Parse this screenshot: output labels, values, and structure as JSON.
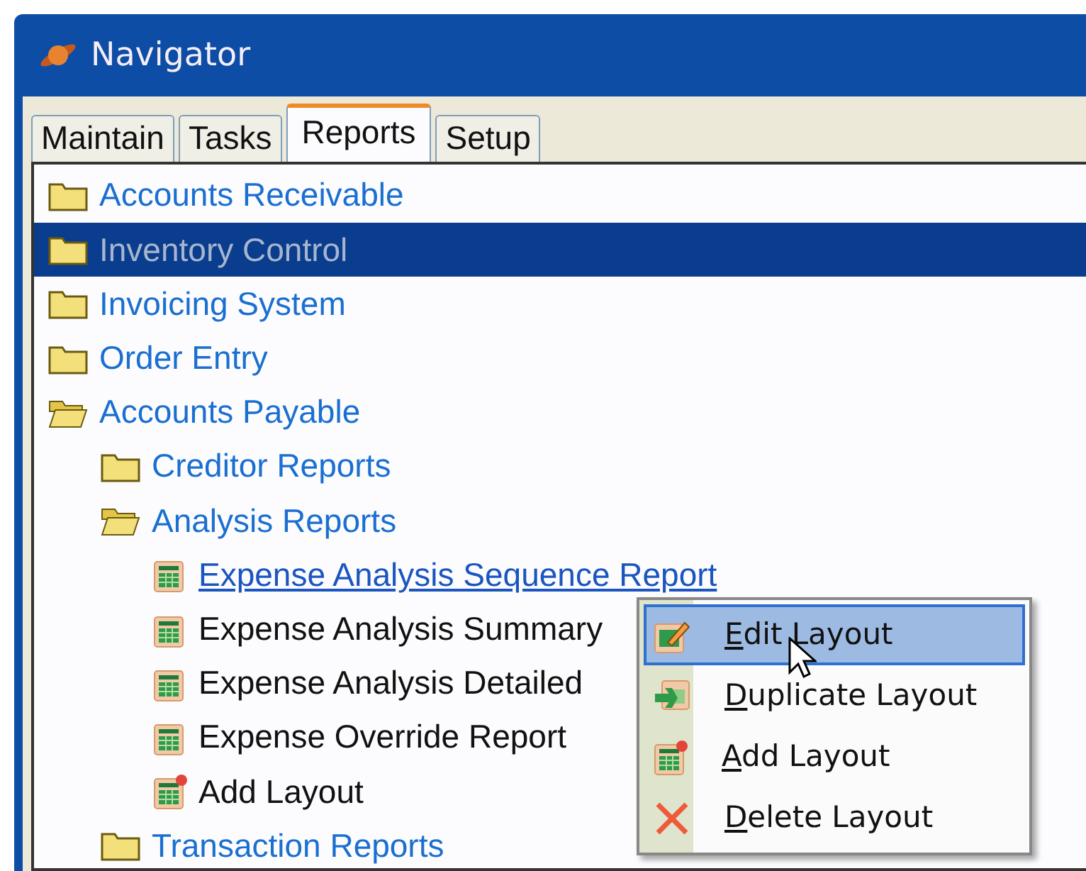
{
  "window": {
    "title": "Navigator"
  },
  "tabs": [
    {
      "label": "Maintain",
      "selected": false
    },
    {
      "label": "Tasks",
      "selected": false
    },
    {
      "label": "Reports",
      "selected": true
    },
    {
      "label": "Setup",
      "selected": false
    }
  ],
  "tree": [
    {
      "label": "Accounts Receivable",
      "kind": "folder",
      "expanded": false,
      "selected": false
    },
    {
      "label": "Inventory Control",
      "kind": "folder",
      "expanded": false,
      "selected": true
    },
    {
      "label": "Invoicing System",
      "kind": "folder",
      "expanded": false,
      "selected": false
    },
    {
      "label": "Order Entry",
      "kind": "folder",
      "expanded": false,
      "selected": false
    },
    {
      "label": "Accounts Payable",
      "kind": "folder",
      "expanded": true,
      "selected": false,
      "children": [
        {
          "label": "Creditor Reports",
          "kind": "folder",
          "expanded": false,
          "selected": false
        },
        {
          "label": "Analysis Reports",
          "kind": "folder",
          "expanded": true,
          "selected": false,
          "children": [
            {
              "label": "Expense Analysis Sequence Report",
              "kind": "report",
              "hovered": true,
              "selected": false
            },
            {
              "label": "Expense Analysis Summary",
              "kind": "report",
              "hovered": false,
              "selected": false
            },
            {
              "label": "Expense Analysis Detailed",
              "kind": "report",
              "hovered": false,
              "selected": false
            },
            {
              "label": "Expense Override Report",
              "kind": "report",
              "hovered": false,
              "selected": false
            },
            {
              "label": "Add Layout",
              "kind": "add",
              "hovered": false,
              "selected": false
            }
          ]
        },
        {
          "label": "Transaction Reports",
          "kind": "folder",
          "expanded": false,
          "selected": false
        }
      ]
    }
  ],
  "context_menu": [
    {
      "label": "Edit Layout",
      "kind": "edit",
      "selected": true
    },
    {
      "label": "Duplicate Layout",
      "kind": "duplicate",
      "selected": false
    },
    {
      "label": "Add Layout",
      "kind": "add",
      "selected": false
    },
    {
      "label": "Delete Layout",
      "kind": "delete",
      "selected": false
    }
  ]
}
